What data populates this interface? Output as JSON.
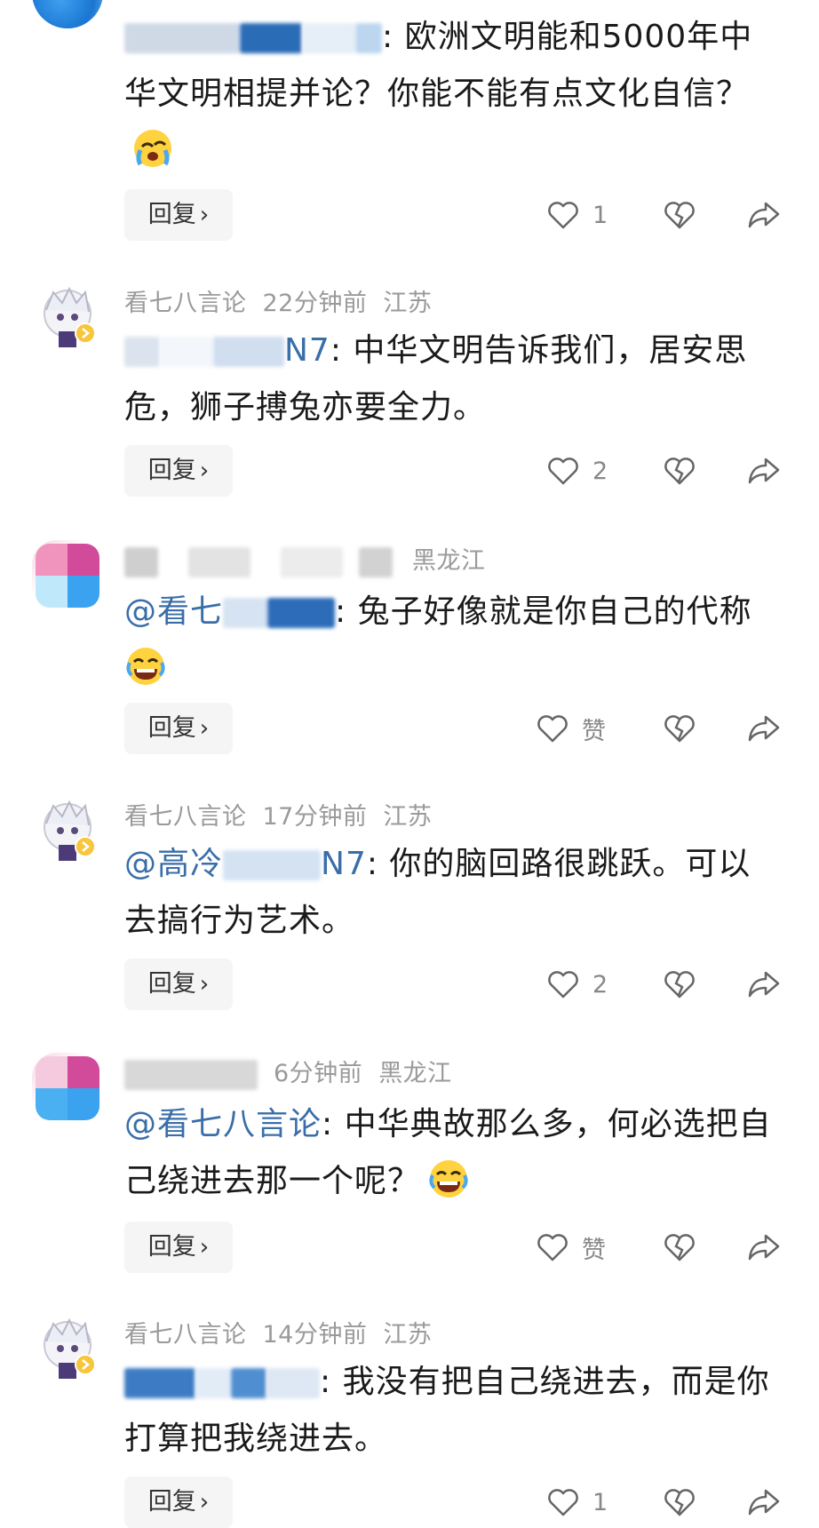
{
  "comments": [
    {
      "avatar": "blue",
      "meta": {
        "name": "",
        "time": "",
        "location": ""
      },
      "text_prefix": "",
      "mention_handle": "@我**明**",
      "text": ": 欧洲文明能和5000年中华文明相提并论？你能不能有点文化自信？",
      "emoji": "crying-emoji",
      "reply_label": "回复",
      "like_count": "1"
    },
    {
      "avatar": "anime",
      "meta": {
        "name": "看七八言论",
        "time": "22分钟前",
        "location": "江苏"
      },
      "mention_handle": "****N7",
      "text": ": 中华文明告诉我们，居安思危，狮子搏兔亦要全力。",
      "emoji": "",
      "reply_label": "回复",
      "like_count": "2"
    },
    {
      "avatar": "pink",
      "meta": {
        "name": "****NT****",
        "time": "",
        "location": "黑龙江"
      },
      "mention_handle": "@看七八言论",
      "text": ": 兔子好像就是你自己的代称",
      "emoji": "laughing-emoji",
      "reply_label": "回复",
      "like_count": "赞"
    },
    {
      "avatar": "anime",
      "meta": {
        "name": "看七八言论",
        "time": "17分钟前",
        "location": "江苏"
      },
      "mention_handle": "@高冷****N7",
      "text": ": 你的脑回路很跳跃。可以去搞行为艺术。",
      "emoji": "",
      "reply_label": "回复",
      "like_count": "2"
    },
    {
      "avatar": "pink",
      "meta": {
        "name": "高冷高山****",
        "time": "6分钟前",
        "location": "黑龙江"
      },
      "mention_handle": "@看七八言论",
      "text": ": 中华典故那么多，何必选把自己绕进去那一个呢？",
      "emoji": "laughing-emoji",
      "reply_label": "回复",
      "like_count": "赞"
    },
    {
      "avatar": "anime",
      "meta": {
        "name": "看七八言论",
        "time": "14分钟前",
        "location": "江苏"
      },
      "mention_handle": "@高****N7",
      "text": ": 我没有把自己绕进去，而是你打算把我绕进去。",
      "emoji": "",
      "reply_label": "回复",
      "like_count": "1"
    }
  ],
  "colors": {
    "mention": "#3a6ea8",
    "meta": "#9a9a9a",
    "reply_bg": "#f5f5f5"
  }
}
